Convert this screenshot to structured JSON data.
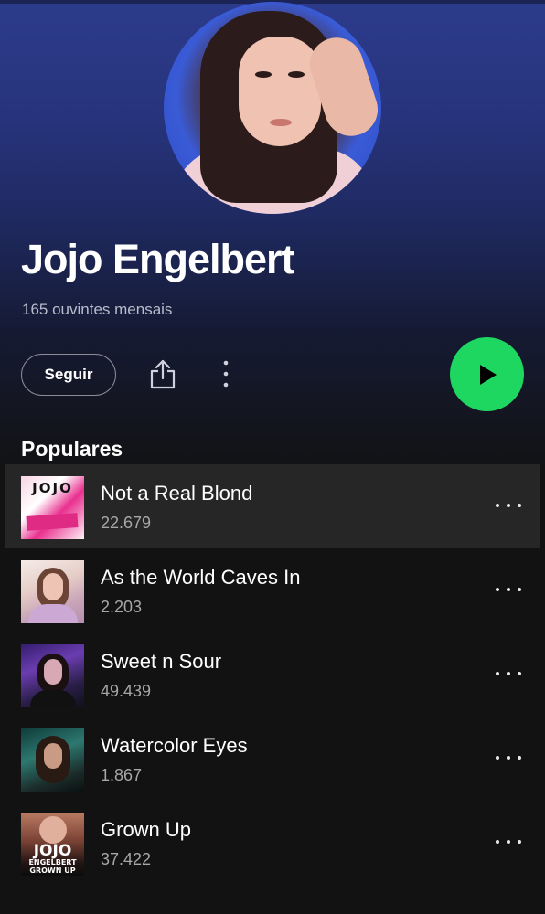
{
  "artist": {
    "name": "Jojo Engelbert",
    "listeners": "165 ouvintes mensais"
  },
  "actions": {
    "follow_label": "Seguir"
  },
  "popular": {
    "title": "Populares",
    "tracks": [
      {
        "title": "Not a Real Blond",
        "plays": "22.679"
      },
      {
        "title": "As the World Caves In",
        "plays": "2.203"
      },
      {
        "title": "Sweet n Sour",
        "plays": "49.439"
      },
      {
        "title": "Watercolor Eyes",
        "plays": "1.867"
      },
      {
        "title": "Grown Up",
        "plays": "37.422"
      }
    ]
  },
  "covers": {
    "cover_1_text": "JOJO",
    "cover_5_line_1": "JOJO",
    "cover_5_line_2": "ENGELBERT",
    "cover_5_line_3": "GROWN UP"
  },
  "colors": {
    "accent": "#1ed760",
    "hero_top": "#2c3b8c",
    "background": "#121212"
  }
}
